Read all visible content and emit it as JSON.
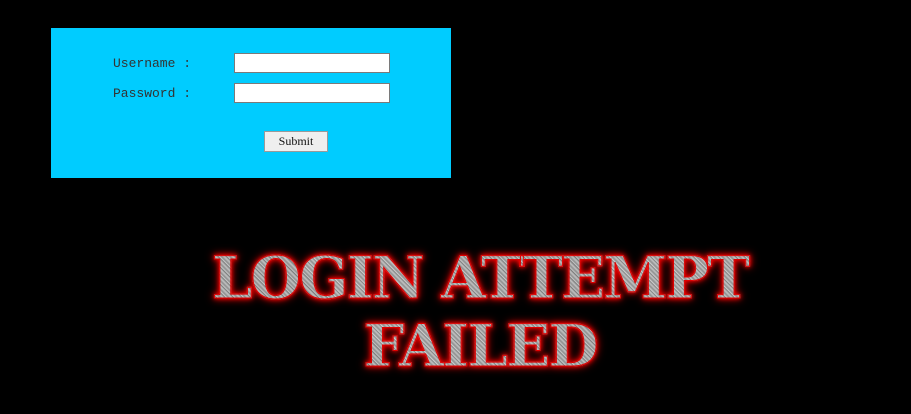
{
  "login_form": {
    "username_label": "Username :",
    "password_label": "Password :",
    "username_value": "",
    "password_value": "",
    "submit_label": "Submit",
    "panel_color": "#00ccff"
  },
  "message": {
    "line1": "LOGIN ATTEMPT",
    "line2": "FAILED",
    "glow_color": "#ff0000"
  },
  "page": {
    "background_color": "#000000"
  }
}
